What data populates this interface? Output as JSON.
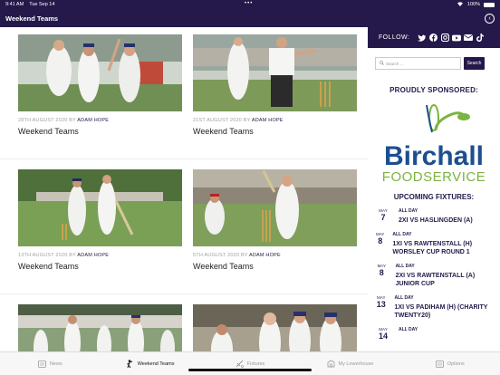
{
  "status_bar": {
    "time": "9:41 AM",
    "date": "Tue Sep 14",
    "battery": "100%"
  },
  "nav": {
    "title": "Weekend Teams"
  },
  "articles": [
    {
      "meta_date": "28TH AUGUST 2020",
      "meta_by": "BY",
      "author": "ADAM HOPE",
      "title": "Weekend Teams"
    },
    {
      "meta_date": "21ST AUGUST 2020",
      "meta_by": "BY",
      "author": "ADAM HOPE",
      "title": "Weekend Teams"
    },
    {
      "meta_date": "13TH AUGUST 2020",
      "meta_by": "BY",
      "author": "ADAM HOPE",
      "title": "Weekend Teams"
    },
    {
      "meta_date": "5TH AUGUST 2020",
      "meta_by": "BY",
      "author": "ADAM HOPE",
      "title": "Weekend Teams"
    }
  ],
  "sidebar": {
    "follow_label": "FOLLOW:",
    "social_icons": [
      "twitter-icon",
      "facebook-icon",
      "instagram-icon",
      "youtube-icon",
      "email-icon",
      "tiktok-icon"
    ],
    "search_placeholder": "Search ...",
    "search_button": "Search",
    "sponsor_heading": "PROUDLY SPONSORED:",
    "sponsor_name": "Birchall",
    "sponsor_sub": "FOODSERVICE",
    "fixtures_heading": "UPCOMING FIXTURES:",
    "fixtures": [
      {
        "month": "MAY",
        "day": "7",
        "time": "ALL DAY",
        "name": "2XI VS HASLINGDEN (A)"
      },
      {
        "month": "MAY",
        "day": "8",
        "time": "ALL DAY",
        "name": "1XI VS RAWTENSTALL (H) WORSLEY CUP ROUND 1"
      },
      {
        "month": "MAY",
        "day": "8",
        "time": "ALL DAY",
        "name": "2XI VS RAWTENSTALL (A) JUNIOR CUP"
      },
      {
        "month": "MAY",
        "day": "13",
        "time": "ALL DAY",
        "name": "1XI VS PADIHAM (H) (CHARITY TWENTY20)"
      },
      {
        "month": "MAY",
        "day": "14",
        "time": "ALL DAY",
        "name": ""
      }
    ]
  },
  "tabs": [
    {
      "label": "News",
      "icon": "news-icon",
      "active": false
    },
    {
      "label": "Weekend Teams",
      "icon": "cricket-player-icon",
      "active": true
    },
    {
      "label": "Fixtures",
      "icon": "fixtures-icon",
      "active": false
    },
    {
      "label": "My Lowerhouse",
      "icon": "stadium-icon",
      "active": false
    },
    {
      "label": "Options",
      "icon": "options-icon",
      "active": false
    }
  ],
  "colors": {
    "brand": "#24194a",
    "sponsor_blue": "#1d4f8f",
    "sponsor_green": "#7cb342"
  }
}
